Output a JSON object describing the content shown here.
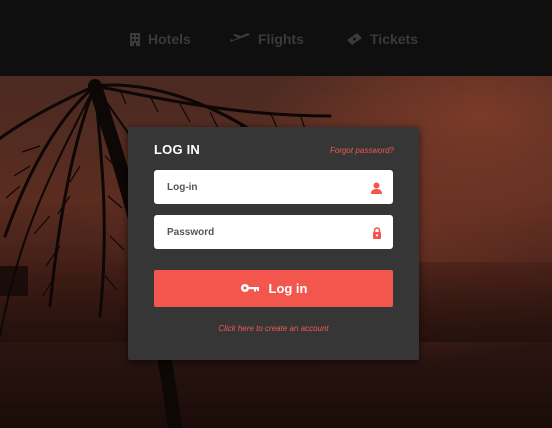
{
  "nav": {
    "items": [
      {
        "label": "Hotels",
        "icon": "building-icon"
      },
      {
        "label": "Flights",
        "icon": "airplane-icon"
      },
      {
        "label": "Tickets",
        "icon": "ticket-icon"
      }
    ]
  },
  "login": {
    "title": "LOG IN",
    "forgot_label": "Forgot password?",
    "login_placeholder": "Log-in",
    "password_placeholder": "Password",
    "submit_label": "Log in",
    "create_account_label": "Click here to create an account"
  },
  "colors": {
    "accent": "#f2564c",
    "card_bg": "#363637",
    "nav_bg": "#0f0f10"
  }
}
